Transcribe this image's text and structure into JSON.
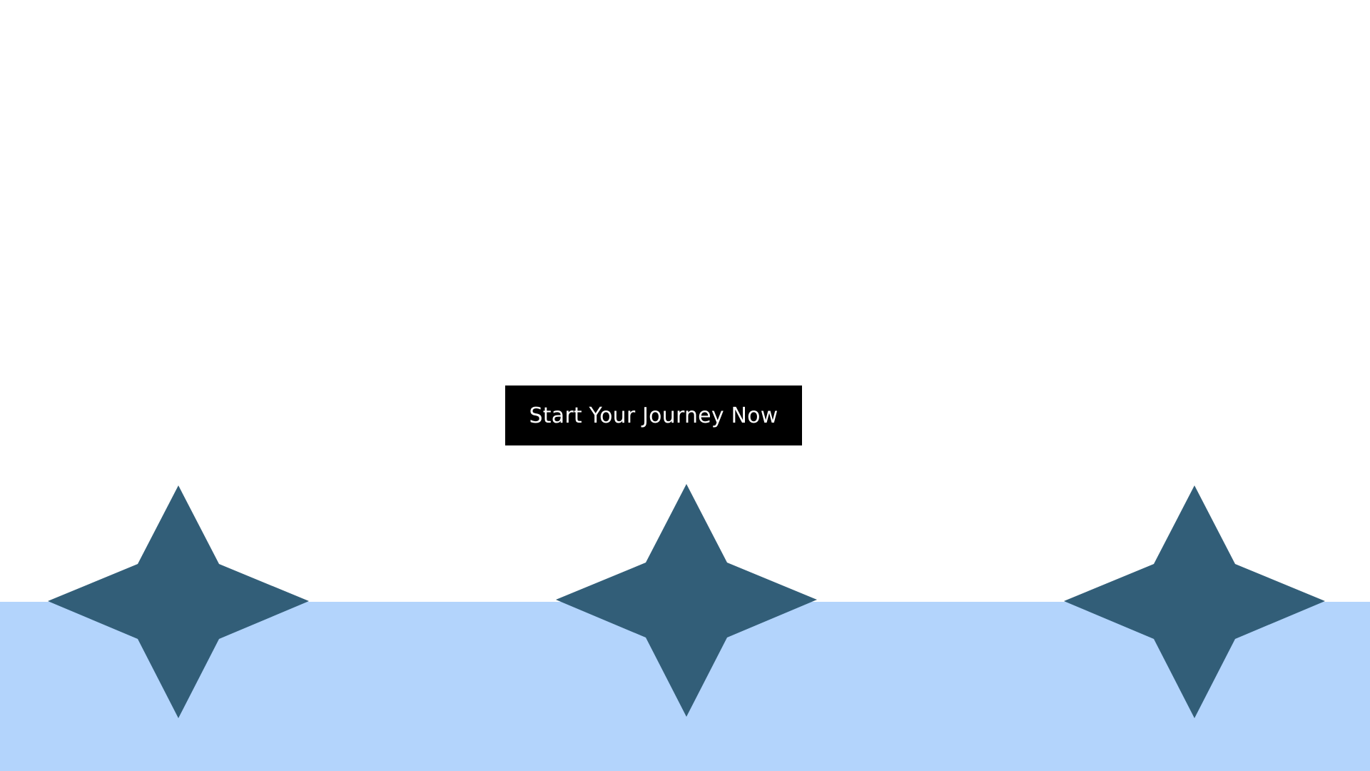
{
  "cta": {
    "label": "Start Your Journey Now"
  },
  "colors": {
    "background": "#ffffff",
    "band": "#b3d4fc",
    "button": "#000000",
    "button_text": "#ffffff",
    "sparkle": "#325e78"
  },
  "decorations": {
    "icons": [
      "sparkle-star-icon",
      "sparkle-star-icon",
      "sparkle-star-icon"
    ]
  }
}
